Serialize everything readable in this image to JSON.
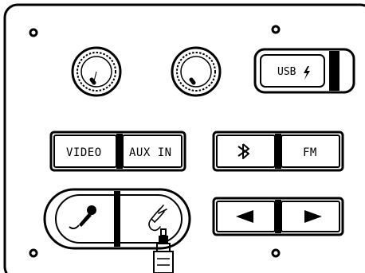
{
  "panel": {
    "usb_label": "USB",
    "video_label": "VIDEO",
    "aux_in_label": "AUX IN",
    "fm_label": "FM",
    "icons": {
      "usb_charge": "lightning-bolt",
      "bluetooth": "bluetooth",
      "microphone": "microphone",
      "guitar": "guitar-cable",
      "prev": "left-triangle",
      "next": "right-triangle",
      "jack": "audio-jack-plug"
    },
    "colors": {
      "ink": "#000000",
      "background": "#ffffff"
    }
  }
}
